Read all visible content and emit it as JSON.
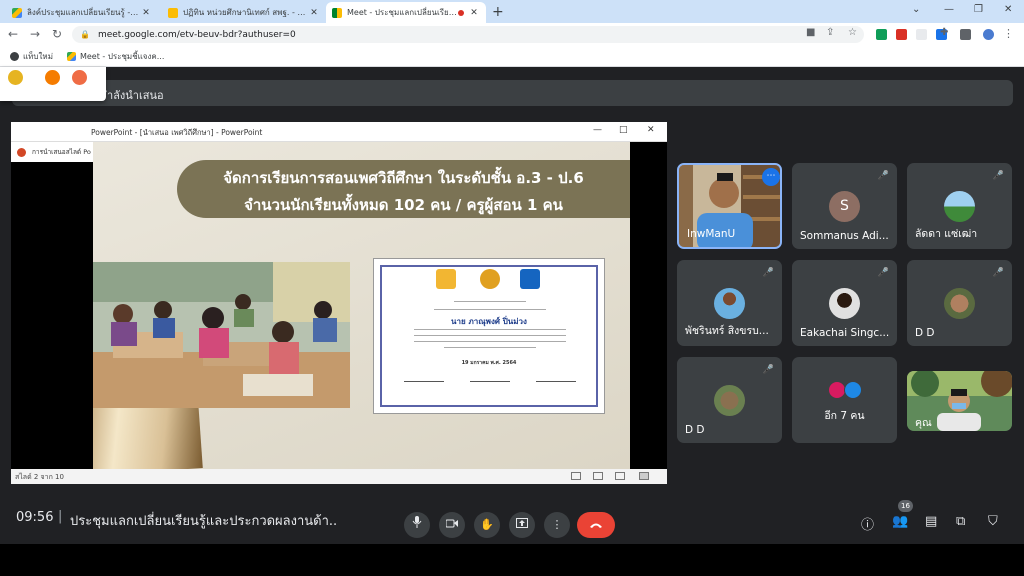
{
  "browser": {
    "tabs": [
      {
        "title": "ลิงค์ประชุมแลกเปลี่ยนเรียนรู้ - Google",
        "active": false
      },
      {
        "title": "ปฏิทิน หน่วยศึกษานิเทศก์ สพฐ. - แผ่น",
        "active": false
      },
      {
        "title": "Meet - ประชุมแลกเปลี่ยนเรียนรู้",
        "active": true
      }
    ],
    "new_tab": "+",
    "minimize": "⌄",
    "url": "meet.google.com/etv-beuv-bdr?authuser=0",
    "bookmarks": [
      {
        "label": "แท็บใหม่",
        "icon": "globe-icon"
      },
      {
        "label": "Meet - ประชุมชี้แจงค...",
        "icon": "drive-icon"
      }
    ]
  },
  "meet": {
    "presenting_banner": "ำลังนำเสนอ",
    "presentation": {
      "window_title": "PowerPoint - [นำเสนอ เพศวิถีศึกษา] - PowerPoint",
      "taskbar_label": "การนำเสนอสไลด์ Po",
      "status": "สไลด์ 2 จาก 10",
      "slide": {
        "line1": "จัดการเรียนการสอนเพศวิถีศึกษา ในระดับชั้น อ.3 - ป.6",
        "line2": "จำนวนนักเรียนทั้งหมด 102 คน / ครูผู้สอน 1 คน",
        "certificate": {
          "name": "นาย ภาณุพงศ์ ปิ่นม่วง",
          "date": "19 มกราคม พ.ศ. 2564",
          "logo_text": "สสส"
        }
      }
    },
    "participants": [
      {
        "name": "InwManU",
        "self": true
      },
      {
        "name": "Sommanus Adi...",
        "avatar_letter": "S"
      },
      {
        "name": "ลัดดา แซ่เฒ่า"
      },
      {
        "name": "พัชรินทร์ สิงขรบ..."
      },
      {
        "name": "Eakachai Singc..."
      },
      {
        "name": "D D"
      },
      {
        "name": "D D"
      },
      {
        "name": "อีก 7 คน"
      },
      {
        "name": "คุณ"
      }
    ],
    "bottom": {
      "time": "09:56",
      "separator": "|",
      "title": "ประชุมแลกเปลี่ยนเรียนรู้และประกวดผลงานด้า...",
      "participant_count": "16"
    }
  },
  "colors": {
    "meet_bg": "#202124",
    "tile_bg": "#3c4043",
    "end_call": "#ea4335",
    "tab_strip": "#cde1f8",
    "banner": "#7b7355"
  }
}
